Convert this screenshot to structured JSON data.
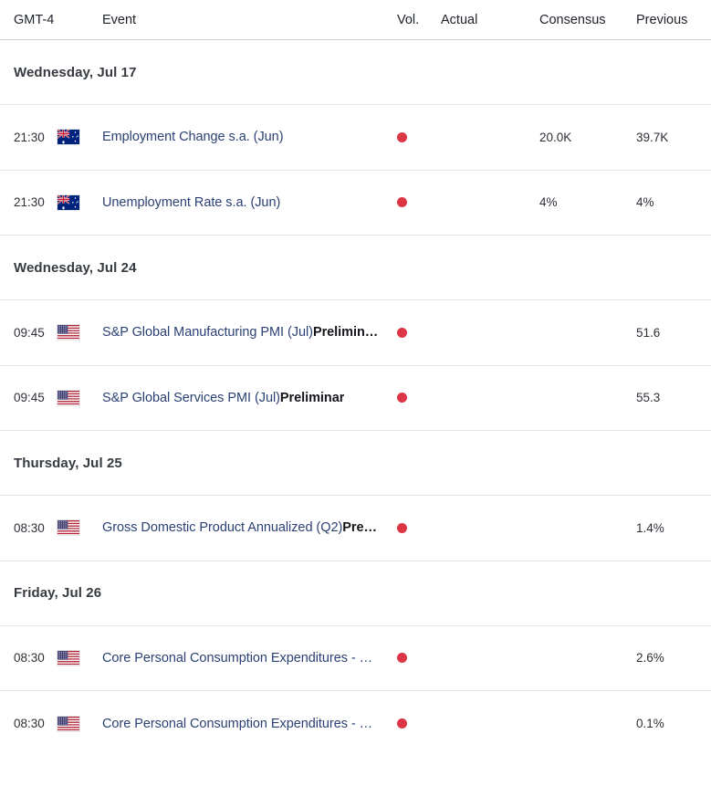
{
  "header": {
    "timezone_label": "GMT-4",
    "event_label": "Event",
    "vol_label": "Vol.",
    "actual_label": "Actual",
    "consensus_label": "Consensus",
    "previous_label": "Previous"
  },
  "colors": {
    "volatility_high": "#dc3545",
    "event_link": "#2b4073",
    "qualifier_text": "#14161a",
    "row_divider": "#e3e6e9",
    "header_divider": "#c9cfd4"
  },
  "groups": [
    {
      "date_label": "Wednesday, Jul 17",
      "rows": [
        {
          "time": "21:30",
          "flag": "flag-australia-icon",
          "country": "Australia",
          "event_main": "Employment Change s.a. (Jun)",
          "event_qualifier": "",
          "volatility": "high",
          "volatility_icon": "volatility-dot-icon",
          "actual": "",
          "consensus": "20.0K",
          "previous": "39.7K"
        },
        {
          "time": "21:30",
          "flag": "flag-australia-icon",
          "country": "Australia",
          "event_main": "Unemployment Rate s.a. (Jun)",
          "event_qualifier": "",
          "volatility": "high",
          "volatility_icon": "volatility-dot-icon",
          "actual": "",
          "consensus": "4%",
          "previous": "4%"
        }
      ]
    },
    {
      "date_label": "Wednesday, Jul 24",
      "rows": [
        {
          "time": "09:45",
          "flag": "flag-united-states-icon",
          "country": "United States",
          "event_main": "S&P Global Manufacturing PMI (Jul)",
          "event_qualifier": "Prelimin…",
          "volatility": "high",
          "volatility_icon": "volatility-dot-icon",
          "actual": "",
          "consensus": "",
          "previous": "51.6"
        },
        {
          "time": "09:45",
          "flag": "flag-united-states-icon",
          "country": "United States",
          "event_main": "S&P Global Services PMI (Jul)",
          "event_qualifier": "Preliminar",
          "volatility": "high",
          "volatility_icon": "volatility-dot-icon",
          "actual": "",
          "consensus": "",
          "previous": "55.3"
        }
      ]
    },
    {
      "date_label": "Thursday, Jul 25",
      "rows": [
        {
          "time": "08:30",
          "flag": "flag-united-states-icon",
          "country": "United States",
          "event_main": "Gross Domestic Product Annualized (Q2)",
          "event_qualifier": "Pre…",
          "volatility": "high",
          "volatility_icon": "volatility-dot-icon",
          "actual": "",
          "consensus": "",
          "previous": "1.4%"
        }
      ]
    },
    {
      "date_label": "Friday, Jul 26",
      "rows": [
        {
          "time": "08:30",
          "flag": "flag-united-states-icon",
          "country": "United States",
          "event_main": "Core Personal Consumption Expenditures - …",
          "event_qualifier": "",
          "volatility": "high",
          "volatility_icon": "volatility-dot-icon",
          "actual": "",
          "consensus": "",
          "previous": "2.6%"
        },
        {
          "time": "08:30",
          "flag": "flag-united-states-icon",
          "country": "United States",
          "event_main": "Core Personal Consumption Expenditures - …",
          "event_qualifier": "",
          "volatility": "high",
          "volatility_icon": "volatility-dot-icon",
          "actual": "",
          "consensus": "",
          "previous": "0.1%"
        }
      ]
    }
  ]
}
